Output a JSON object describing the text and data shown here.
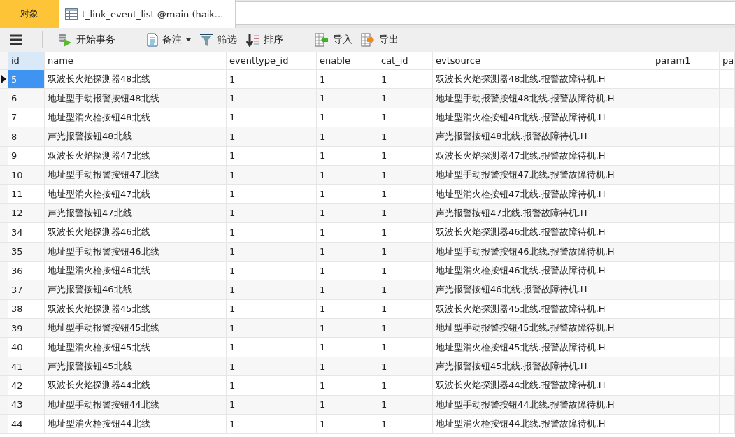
{
  "tabs": [
    {
      "label": "对象",
      "kind": "objects",
      "selected": false
    },
    {
      "label": "t_link_event_list @main (haik...",
      "kind": "table",
      "selected": true
    }
  ],
  "toolbar": [
    {
      "kind": "menu"
    },
    {
      "label": "开始事务",
      "kind": "transaction"
    },
    {
      "label": "备注",
      "kind": "memo"
    },
    {
      "label": "筛选",
      "kind": "filter"
    },
    {
      "label": "排序",
      "kind": "sort"
    },
    {
      "label": "导入",
      "kind": "import"
    },
    {
      "label": "导出",
      "kind": "export"
    }
  ],
  "table": {
    "columns": [
      "id",
      "name",
      "eventtype_id",
      "enable",
      "cat_id",
      "evtsource",
      "param1",
      "pa"
    ],
    "rows": [
      {
        "id": "5",
        "name": "双波长火焰探测器48北线",
        "eventtype_id": "1",
        "enable": "1",
        "cat_id": "1",
        "evtsource": "双波长火焰探测器48北线.报警故障待机.H",
        "selected": true
      },
      {
        "id": "6",
        "name": "地址型手动报警按钮48北线",
        "eventtype_id": "1",
        "enable": "1",
        "cat_id": "1",
        "evtsource": "地址型手动报警按钮48北线.报警故障待机.H",
        "selected": false
      },
      {
        "id": "7",
        "name": "地址型消火栓按钮48北线",
        "eventtype_id": "1",
        "enable": "1",
        "cat_id": "1",
        "evtsource": "地址型消火栓按钮48北线.报警故障待机.H",
        "selected": false
      },
      {
        "id": "8",
        "name": "声光报警按钮48北线",
        "eventtype_id": "1",
        "enable": "1",
        "cat_id": "1",
        "evtsource": "声光报警按钮48北线.报警故障待机.H",
        "selected": false
      },
      {
        "id": "9",
        "name": "双波长火焰探测器47北线",
        "eventtype_id": "1",
        "enable": "1",
        "cat_id": "1",
        "evtsource": "双波长火焰探测器47北线.报警故障待机.H",
        "selected": false
      },
      {
        "id": "10",
        "name": "地址型手动报警按钮47北线",
        "eventtype_id": "1",
        "enable": "1",
        "cat_id": "1",
        "evtsource": "地址型手动报警按钮47北线.报警故障待机.H",
        "selected": false
      },
      {
        "id": "11",
        "name": "地址型消火栓按钮47北线",
        "eventtype_id": "1",
        "enable": "1",
        "cat_id": "1",
        "evtsource": "地址型消火栓按钮47北线.报警故障待机.H",
        "selected": false
      },
      {
        "id": "12",
        "name": "声光报警按钮47北线",
        "eventtype_id": "1",
        "enable": "1",
        "cat_id": "1",
        "evtsource": "声光报警按钮47北线.报警故障待机.H",
        "selected": false
      },
      {
        "id": "34",
        "name": "双波长火焰探测器46北线",
        "eventtype_id": "1",
        "enable": "1",
        "cat_id": "1",
        "evtsource": "双波长火焰探测器46北线.报警故障待机.H",
        "selected": false
      },
      {
        "id": "35",
        "name": "地址型手动报警按钮46北线",
        "eventtype_id": "1",
        "enable": "1",
        "cat_id": "1",
        "evtsource": "地址型手动报警按钮46北线.报警故障待机.H",
        "selected": false
      },
      {
        "id": "36",
        "name": "地址型消火栓按钮46北线",
        "eventtype_id": "1",
        "enable": "1",
        "cat_id": "1",
        "evtsource": "地址型消火栓按钮46北线.报警故障待机.H",
        "selected": false
      },
      {
        "id": "37",
        "name": "声光报警按钮46北线",
        "eventtype_id": "1",
        "enable": "1",
        "cat_id": "1",
        "evtsource": "声光报警按钮46北线.报警故障待机.H",
        "selected": false
      },
      {
        "id": "38",
        "name": "双波长火焰探测器45北线",
        "eventtype_id": "1",
        "enable": "1",
        "cat_id": "1",
        "evtsource": "双波长火焰探测器45北线.报警故障待机.H",
        "selected": false
      },
      {
        "id": "39",
        "name": "地址型手动报警按钮45北线",
        "eventtype_id": "1",
        "enable": "1",
        "cat_id": "1",
        "evtsource": "地址型手动报警按钮45北线.报警故障待机.H",
        "selected": false
      },
      {
        "id": "40",
        "name": "地址型消火栓按钮45北线",
        "eventtype_id": "1",
        "enable": "1",
        "cat_id": "1",
        "evtsource": "地址型消火栓按钮45北线.报警故障待机.H",
        "selected": false
      },
      {
        "id": "41",
        "name": "声光报警按钮45北线",
        "eventtype_id": "1",
        "enable": "1",
        "cat_id": "1",
        "evtsource": "声光报警按钮45北线.报警故障待机.H",
        "selected": false
      },
      {
        "id": "42",
        "name": "双波长火焰探测器44北线",
        "eventtype_id": "1",
        "enable": "1",
        "cat_id": "1",
        "evtsource": "双波长火焰探测器44北线.报警故障待机.H",
        "selected": false
      },
      {
        "id": "43",
        "name": "地址型手动报警按钮44北线",
        "eventtype_id": "1",
        "enable": "1",
        "cat_id": "1",
        "evtsource": "地址型手动报警按钮44北线.报警故障待机.H",
        "selected": false
      },
      {
        "id": "44",
        "name": "地址型消火栓按钮44北线",
        "eventtype_id": "1",
        "enable": "1",
        "cat_id": "1",
        "evtsource": "地址型消火栓按钮44北线.报警故障待机.H",
        "selected": false
      }
    ]
  }
}
